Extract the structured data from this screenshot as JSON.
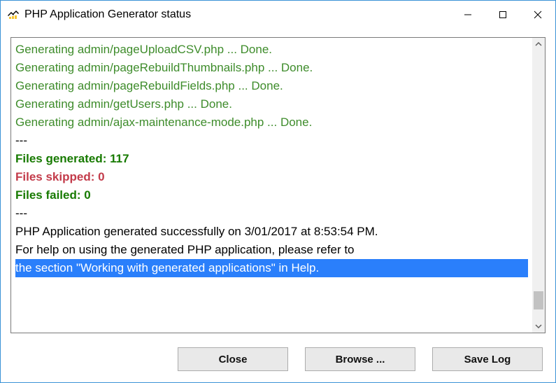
{
  "titlebar": {
    "title": "PHP Application Generator status"
  },
  "log": {
    "lines": [
      {
        "cls": "green",
        "text": "Generating admin/pageUploadCSV.php ... Done."
      },
      {
        "cls": "green",
        "text": "Generating admin/pageRebuildThumbnails.php ... Done."
      },
      {
        "cls": "green",
        "text": "Generating admin/pageRebuildFields.php ... Done."
      },
      {
        "cls": "green",
        "text": "Generating admin/getUsers.php ... Done."
      },
      {
        "cls": "green",
        "text": "Generating admin/ajax-maintenance-mode.php ... Done."
      },
      {
        "cls": "sep",
        "text": "---"
      },
      {
        "cls": "greenb",
        "text": "Files generated: 117"
      },
      {
        "cls": "redb",
        "text": "Files skipped: 0"
      },
      {
        "cls": "greenb",
        "text": "Files failed: 0"
      },
      {
        "cls": "sep",
        "text": "---"
      },
      {
        "cls": "black",
        "text": "PHP Application generated successfully on 3/01/2017 at 8:53:54 PM."
      },
      {
        "cls": "black",
        "text": "For help on using the generated PHP application, please refer to"
      },
      {
        "cls": "sel",
        "text": "the section \"Working with generated applications\" in Help."
      }
    ],
    "stats": {
      "generated": 117,
      "skipped": 0,
      "failed": 0,
      "date": "3/01/2017",
      "time": "8:53:54 PM"
    }
  },
  "buttons": {
    "close": "Close",
    "browse": "Browse ...",
    "saveLog": "Save Log"
  }
}
